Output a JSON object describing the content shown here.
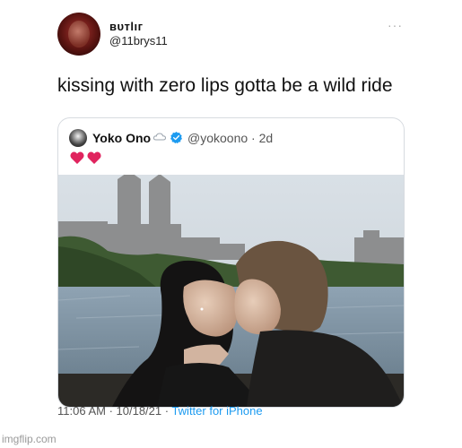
{
  "tweet": {
    "display_name": "ʙᴜᴛlıг",
    "handle": "@11brys11",
    "more_icon": "more-icon",
    "text": "kissing with zero lips gotta be a wild ride"
  },
  "quoted_tweet": {
    "display_name": "Yoko Ono",
    "handle_time": "@yokoono · 2d",
    "icons": [
      "cloud-icon",
      "verified-icon"
    ],
    "hearts": [
      "heart-icon",
      "heart-icon"
    ],
    "photo": "photo-couple-kissing-by-lake"
  },
  "footer": {
    "timestamp": "11:06 AM · 10/18/21 · ",
    "source": "Twitter for iPhone"
  },
  "watermark": "imgflip.com",
  "colors": {
    "link": "#1d9bf0",
    "border": "#d7dbe0",
    "heart": "#e0245e",
    "verified": "#1d9bf0"
  }
}
